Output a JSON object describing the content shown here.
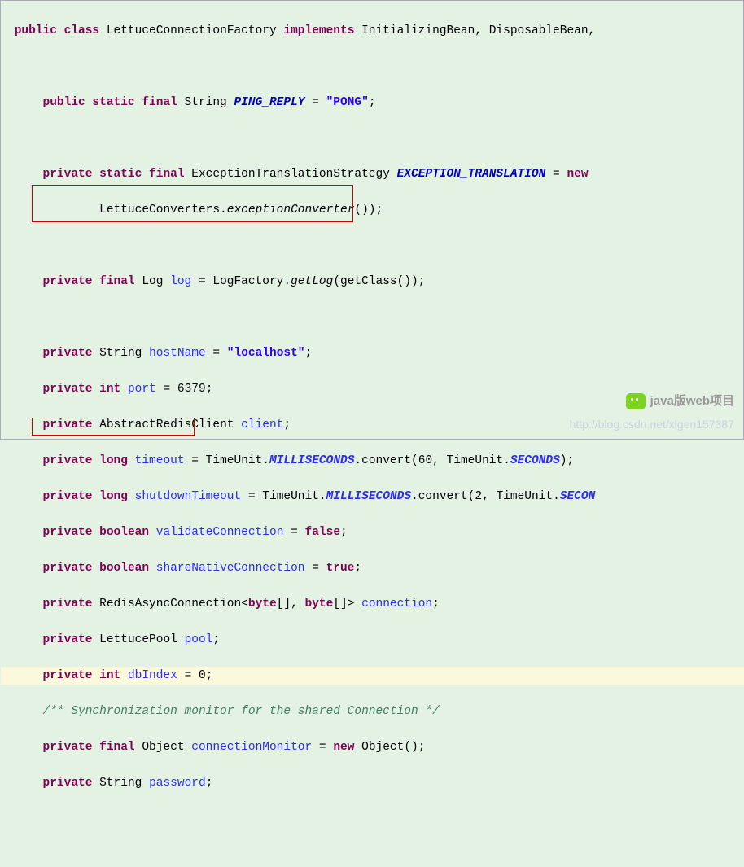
{
  "code": {
    "l1": {
      "kw1": "public",
      "kw2": "class",
      "name": "LettuceConnectionFactory",
      "kw3": "implements",
      "impl": "InitializingBean, DisposableBean,"
    },
    "l3": {
      "mods": "public static final",
      "type": "String",
      "field": "PING_REPLY",
      "eq": " = ",
      "val": "\"PONG\"",
      "end": ";"
    },
    "l5": {
      "mods": "private static final",
      "type": "ExceptionTranslationStrategy",
      "field": "EXCEPTION_TRANSLATION",
      "eq": " = ",
      "kw": "new",
      "rest": " "
    },
    "l6": {
      "cls": "LettuceConverters.",
      "method": "exceptionConverter",
      "rest": "());"
    },
    "l8": {
      "mods": "private final",
      "type": "Log",
      "field": "log",
      "eq": " = LogFactory.",
      "method": "getLog",
      "rest": "(getClass());"
    },
    "l10": {
      "mods": "private",
      "type": "String",
      "field": "hostName",
      "eq": " = ",
      "val": "\"localhost\"",
      "end": ";"
    },
    "l11": {
      "mods": "private",
      "type": "int",
      "field": "port",
      "eq": " = ",
      "num": "6379",
      "end": ";"
    },
    "l12": {
      "mods": "private",
      "type": "AbstractRedisClient",
      "field": "client",
      "end": ";"
    },
    "l13": {
      "mods": "private",
      "type": "long",
      "field": "timeout",
      "eq": " = TimeUnit.",
      "const": "MILLISECONDS",
      "m": ".convert(",
      "num": "60",
      "m2": ", TimeUnit.",
      "const2": "SECONDS",
      "end": ");"
    },
    "l14": {
      "mods": "private",
      "type": "long",
      "field": "shutdownTimeout",
      "eq": " = TimeUnit.",
      "const": "MILLISECONDS",
      "m": ".convert(",
      "num": "2",
      "m2": ", TimeUnit.",
      "const2": "SECON"
    },
    "l15": {
      "mods": "private",
      "type": "boolean",
      "field": "validateConnection",
      "eq": " = ",
      "kw": "false",
      "end": ";"
    },
    "l16": {
      "mods": "private",
      "type": "boolean",
      "field": "shareNativeConnection",
      "eq": " = ",
      "kw": "true",
      "end": ";"
    },
    "l17": {
      "mods": "private",
      "type": "RedisAsyncConnection<",
      "kw1": "byte",
      "g1": "[], ",
      "kw2": "byte",
      "g2": "[]>",
      "field": " connection",
      "end": ";"
    },
    "l18": {
      "mods": "private",
      "type": "LettucePool",
      "field": "pool",
      "end": ";"
    },
    "l19": {
      "mods": "private",
      "type": "int",
      "field": "dbIndex",
      "eq": " = ",
      "num": "0",
      "end": ";"
    },
    "l20": {
      "comment": "/** Synchronization monitor for the shared Connection */"
    },
    "l21": {
      "mods": "private final",
      "type": "Object",
      "field": "connectionMonitor",
      "eq": " = ",
      "kw": "new",
      "rest": " Object();"
    },
    "l22": {
      "mods": "private",
      "type": "String",
      "field": "password",
      "end": ";"
    }
  },
  "watermark": "http://blog.csdn.net/xlgen157387",
  "wechat": "java版web项目"
}
